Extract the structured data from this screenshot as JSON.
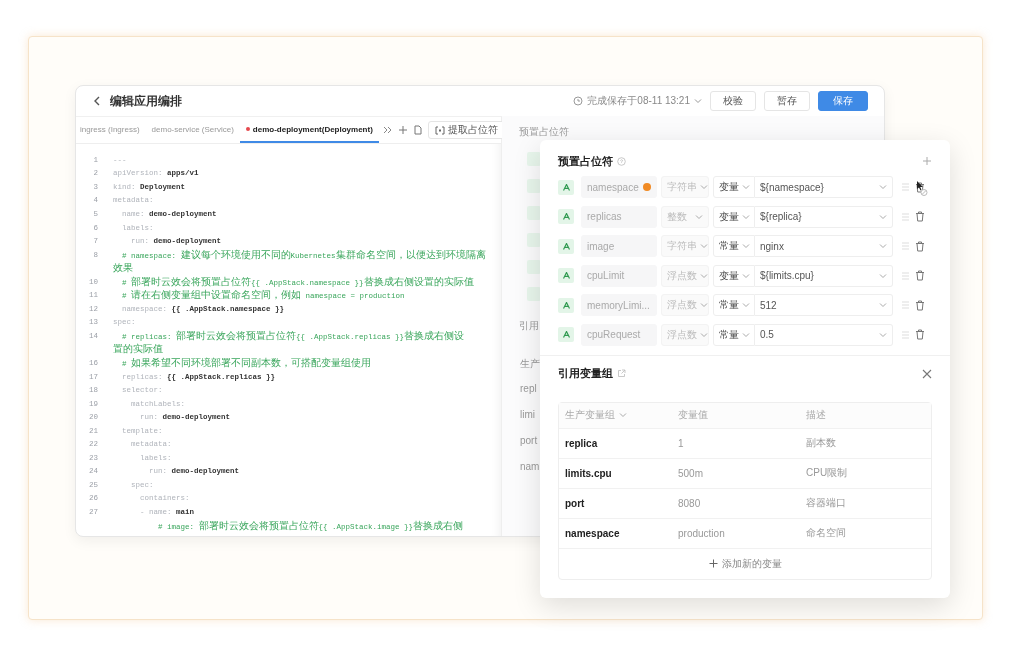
{
  "header": {
    "title": "编辑应用编排",
    "save_status": "完成保存于08-11 13:21",
    "buttons": [
      {
        "label": "校验",
        "primary": false
      },
      {
        "label": "暂存",
        "primary": false
      },
      {
        "label": "保存",
        "primary": true
      }
    ]
  },
  "tabs": [
    {
      "label": "ingress (Ingress)",
      "selected": false,
      "modified": false
    },
    {
      "label": "demo-service (Service)",
      "selected": false,
      "modified": false
    },
    {
      "label": "demo-deployment(Deployment)",
      "selected": true,
      "modified": true
    }
  ],
  "extract_button": "提取占位符",
  "code_lines": [
    {
      "number": "1",
      "kind": "plain",
      "text": "---"
    },
    {
      "number": "2",
      "kind": "pair",
      "key": "apiVersion:",
      "value": "apps/v1"
    },
    {
      "number": "3",
      "kind": "pair",
      "key": "kind:",
      "value": "Deployment"
    },
    {
      "number": "4",
      "kind": "key",
      "key": "metadata:"
    },
    {
      "number": "5",
      "kind": "pair",
      "key": "  name:",
      "value": "demo-deployment"
    },
    {
      "number": "6",
      "kind": "key",
      "key": "  labels:"
    },
    {
      "number": "7",
      "kind": "pair",
      "key": "    run:",
      "value": "demo-deployment"
    },
    {
      "number": "8",
      "kind": "comment",
      "text": "  # namespace: 建议每个环境使用不同的Kubernetes集群命名空间，以便达到环境隔离"
    },
    {
      "kind": "comment",
      "text": "效果"
    },
    {
      "number": "10",
      "kind": "comment",
      "text": "  # 部署时云效会将预置占位符{{ .AppStack.namespace }}替换成右侧设置的实际值"
    },
    {
      "number": "11",
      "kind": "comment",
      "text": "  # 请在右侧变量组中设置命名空间，例如 namespace = production"
    },
    {
      "number": "12",
      "kind": "pair",
      "key": "  namespace:",
      "value": "{{ .AppStack.namespace }}"
    },
    {
      "number": "13",
      "kind": "key",
      "key": "spec:"
    },
    {
      "number": "14",
      "kind": "comment",
      "text": "  # replicas: 部署时云效会将预置占位符{{ .AppStack.replicas }}替换成右侧设"
    },
    {
      "kind": "comment",
      "text": "置的实际值"
    },
    {
      "number": "16",
      "kind": "comment",
      "text": "  # 如果希望不同环境部署不同副本数，可搭配变量组使用"
    },
    {
      "number": "17",
      "kind": "pair",
      "key": "  replicas:",
      "value": "{{ .AppStack.replicas }}"
    },
    {
      "number": "18",
      "kind": "key",
      "key": "  selector:"
    },
    {
      "number": "19",
      "kind": "key",
      "key": "    matchLabels:"
    },
    {
      "number": "20",
      "kind": "pair",
      "key": "      run:",
      "value": "demo-deployment"
    },
    {
      "number": "21",
      "kind": "key",
      "key": "  template:"
    },
    {
      "number": "22",
      "kind": "key",
      "key": "    metadata:"
    },
    {
      "number": "23",
      "kind": "key",
      "key": "      labels:"
    },
    {
      "number": "24",
      "kind": "pair",
      "key": "        run:",
      "value": "demo-deployment"
    },
    {
      "number": "25",
      "kind": "key",
      "key": "    spec:"
    },
    {
      "number": "26",
      "kind": "key",
      "key": "      containers:"
    },
    {
      "number": "27",
      "kind": "pair",
      "key": "      - name:",
      "value": "main"
    },
    {
      "kind": "comment",
      "text": "          # image: 部署时云效会将预置占位符{{ .AppStack.image }}替换成右侧"
    }
  ],
  "background_panel": {
    "title": "预置占位符",
    "section": "引用",
    "texts": [
      "生产",
      "repl",
      "limi",
      "port",
      "nam"
    ]
  },
  "placeholders": {
    "title": "预置占位符",
    "rows": [
      {
        "name": "namespace",
        "warning": true,
        "type": "字符串",
        "source": "变量",
        "value": "${namespace}"
      },
      {
        "name": "replicas",
        "warning": false,
        "type": "整数",
        "source": "变量",
        "value": "${replica}"
      },
      {
        "name": "image",
        "warning": false,
        "type": "字符串",
        "source": "常量",
        "value": "nginx"
      },
      {
        "name": "cpuLimit",
        "warning": false,
        "type": "浮点数",
        "source": "变量",
        "value": "${limits.cpu}"
      },
      {
        "name": "memoryLimi...",
        "warning": false,
        "type": "浮点数",
        "source": "常量",
        "value": "512"
      },
      {
        "name": "cpuRequest",
        "warning": false,
        "type": "浮点数",
        "source": "常量",
        "value": "0.5"
      }
    ]
  },
  "variable_group": {
    "title": "引用变量组",
    "columns": [
      "生产变量组",
      "变量值",
      "描述"
    ],
    "rows": [
      [
        "replica",
        "1",
        "副本数"
      ],
      [
        "limits.cpu",
        "500m",
        "CPU限制"
      ],
      [
        "port",
        "8080",
        "容器端口"
      ],
      [
        "namespace",
        "production",
        "命名空间"
      ]
    ],
    "add_label": "添加新的变量"
  }
}
